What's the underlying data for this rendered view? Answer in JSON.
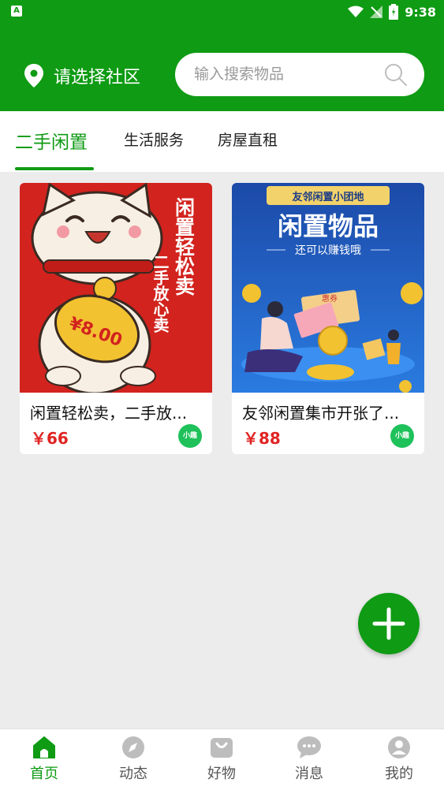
{
  "status_bar": {
    "time": "9:38",
    "app_indicator": "A"
  },
  "header": {
    "location_label": "请选择社区",
    "search": {
      "placeholder": "输入搜索物品",
      "value": ""
    }
  },
  "tabs": [
    {
      "label": "二手闲置",
      "active": true
    },
    {
      "label": "生活服务",
      "active": false
    },
    {
      "label": "房屋直租",
      "active": false
    }
  ],
  "listings": [
    {
      "title": "闲置轻松卖，二手放...",
      "price": "￥66",
      "badge": "小趣",
      "image": {
        "headline": "闲置轻松卖",
        "subline": "二手放心卖",
        "coin_text": "¥8.00"
      }
    },
    {
      "title": "友邻闲置集市开张了...",
      "price": "￥88",
      "badge": "小趣",
      "image": {
        "banner": "友邻闲置小团地",
        "headline": "闲置物品",
        "subline": "还可以赚钱哦",
        "ticket_text": "惠券"
      }
    }
  ],
  "bottom_nav": [
    {
      "label": "首页",
      "icon": "home-icon",
      "active": true
    },
    {
      "label": "动态",
      "icon": "compass-icon",
      "active": false
    },
    {
      "label": "好物",
      "icon": "shopping-bag-icon",
      "active": false
    },
    {
      "label": "消息",
      "icon": "chat-icon",
      "active": false
    },
    {
      "label": "我的",
      "icon": "profile-icon",
      "active": false
    }
  ],
  "colors": {
    "brand_green": "#0f9b14",
    "price_red": "#e02323",
    "badge_green": "#1ec15a"
  }
}
